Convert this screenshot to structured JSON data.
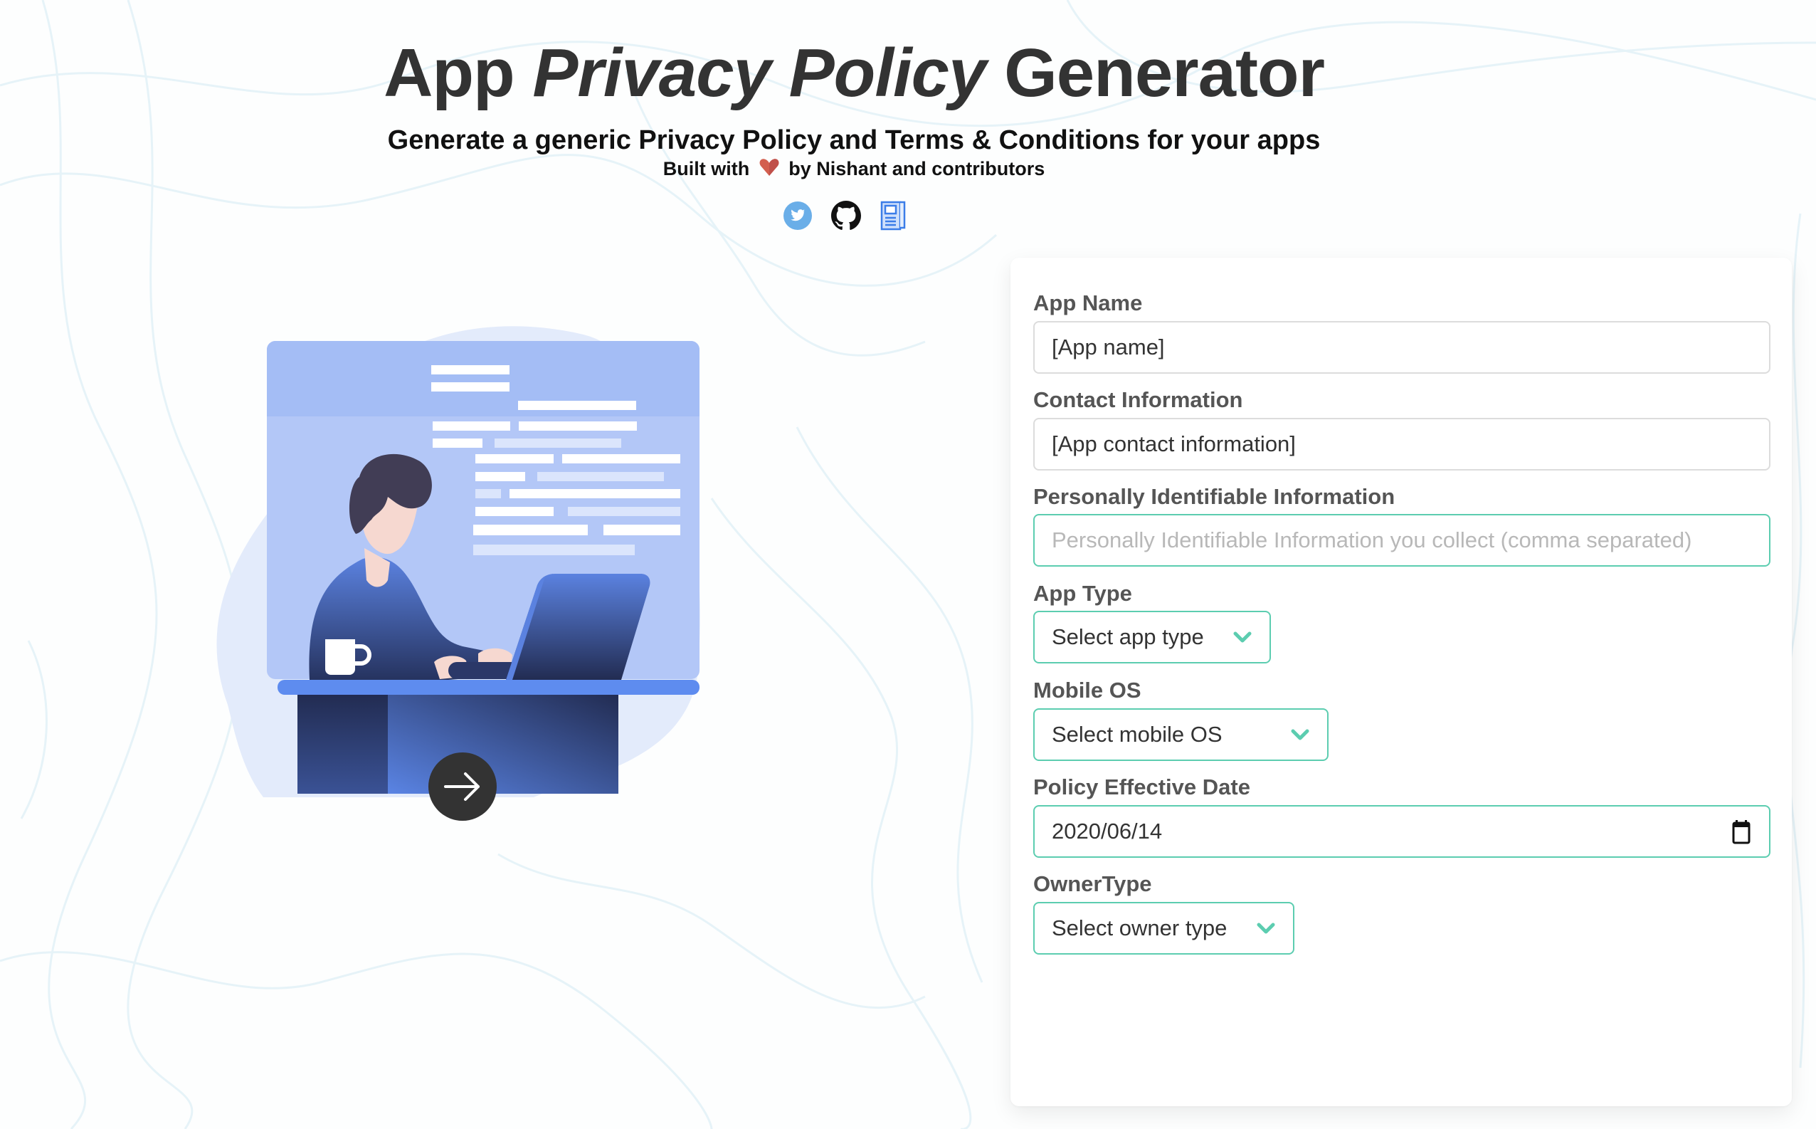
{
  "header": {
    "title_part1": "App",
    "title_part2": "Privacy Policy",
    "title_part3": "Generator",
    "subtitle": "Generate a generic Privacy Policy and Terms & Conditions for your apps",
    "built_prefix": "Built with",
    "built_suffix": "by Nishant and contributors",
    "heart_icon": "heart-icon",
    "social_links": [
      {
        "icon": "twitter-icon",
        "color": "#6aaee8"
      },
      {
        "icon": "github-icon",
        "color": "#111111"
      },
      {
        "icon": "document-icon",
        "color": "#3b7de8"
      }
    ]
  },
  "illustration": {
    "description": "person working on laptop at desk",
    "next_button_icon": "arrow-right-icon"
  },
  "form": {
    "accent_color": "#5ccdb0",
    "fields": [
      {
        "label": "App Name",
        "value": "[App name]",
        "placeholder": ""
      },
      {
        "label": "Contact Information",
        "value": "[App contact information]",
        "placeholder": ""
      },
      {
        "label": "Personally Identifiable Information",
        "value": "",
        "placeholder": "Personally Identifiable Information you collect (comma separated)"
      },
      {
        "label": "App Type",
        "selected": "Select app type"
      },
      {
        "label": "Mobile OS",
        "selected": "Select mobile OS"
      },
      {
        "label": "Policy Effective Date",
        "value": "2020/06/14"
      },
      {
        "label": "OwnerType",
        "selected": "Select owner type"
      }
    ]
  }
}
